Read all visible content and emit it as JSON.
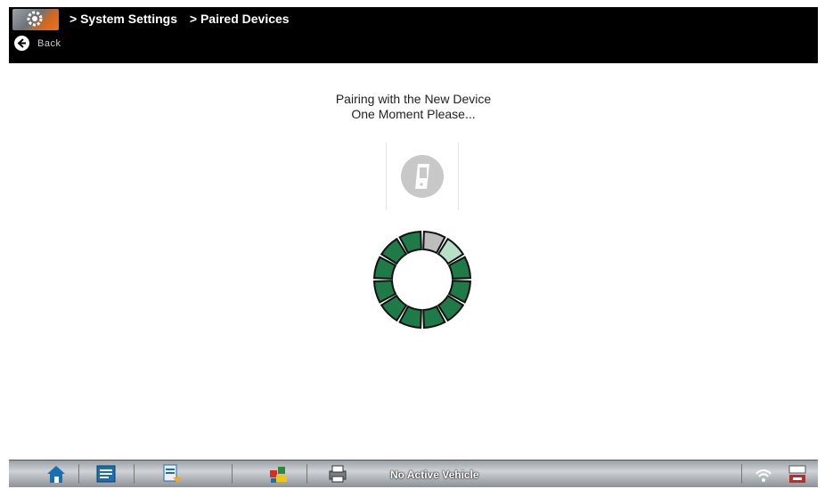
{
  "header": {
    "breadcrumb": [
      "> System Settings",
      "> Paired Devices"
    ],
    "back_label": "Back",
    "app_icon": "settings-gear-icon",
    "back_icon": "back-arrow-icon"
  },
  "main": {
    "message_line1": "Pairing with the New Device",
    "message_line2": "One Moment Please...",
    "device_icon": "mobile-device-icon",
    "spinner_icon": "loading-spinner",
    "colors": {
      "spinner_active": "#1e7b47",
      "spinner_light": "#b8e0c8",
      "spinner_grey": "#bdbdbd"
    }
  },
  "taskbar": {
    "buttons": [
      "home-icon",
      "scanner-icon",
      "data-manager-icon",
      "vehicle-icon",
      "print-icon"
    ],
    "status": "No Active Vehicle",
    "right_icons": [
      "wifi-icon",
      "settings-flag-icon"
    ]
  }
}
